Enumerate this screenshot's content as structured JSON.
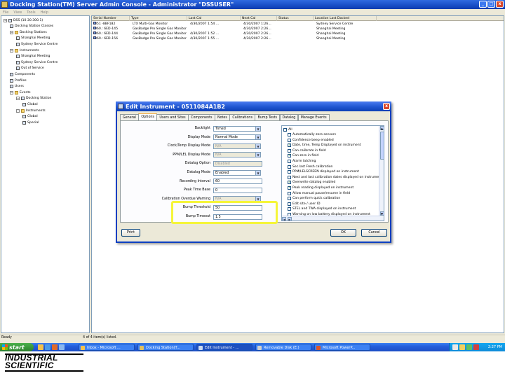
{
  "app": {
    "title": "Docking Station(TM) Server Admin Console - Administrator \"DSSUSER\"",
    "menu": [
      "File",
      "View",
      "Tools",
      "Help"
    ],
    "window_buttons": [
      "_",
      "□",
      "x"
    ]
  },
  "tree": {
    "items": [
      {
        "label": "DSS (10.30.300.1)",
        "icon": "computer-icon",
        "expander": "-"
      },
      {
        "label": "Docking Station Classes",
        "icon": "station-icon"
      },
      {
        "label": "Docking Stations",
        "icon": "station-icon",
        "expander": "-"
      },
      {
        "label": "Shanghai Meeting",
        "icon": "station-icon"
      },
      {
        "label": "Sydney Service Centre",
        "icon": "station-icon"
      },
      {
        "label": "Instruments",
        "icon": "instrument-icon",
        "expander": "-"
      },
      {
        "label": "Shanghai Meeting",
        "icon": "instrument-icon"
      },
      {
        "label": "Sydney Service Centre",
        "icon": "instrument-icon"
      },
      {
        "label": "Out of Service",
        "icon": "instrument-icon"
      },
      {
        "label": "Components",
        "icon": "component-icon"
      },
      {
        "label": "Profiles",
        "icon": "profile-icon"
      },
      {
        "label": "Users",
        "icon": "user-icon"
      },
      {
        "label": "Events",
        "icon": "event-icon",
        "expander": "-"
      },
      {
        "label": "Docking Station",
        "icon": "station-icon",
        "expander": "-"
      },
      {
        "label": "Global",
        "icon": "event-icon"
      },
      {
        "label": "Instruments",
        "icon": "instrument-icon",
        "expander": "-"
      },
      {
        "label": "Global",
        "icon": "event-icon"
      },
      {
        "label": "Special",
        "icon": "event-icon"
      }
    ]
  },
  "list": {
    "columns": [
      "Serial Number",
      "Type",
      "Last Cal",
      "Next Cal",
      "Status",
      "Location Last Docked"
    ],
    "rows": [
      [
        "051 -8BF182",
        "LTX Multi-Gas Monitor",
        "4/30/2007 1:54 ...",
        "4/30/2007 1:26...",
        "",
        "Sydney Service Centre"
      ],
      [
        "060.: 6ED-145",
        "GasBadge Pro Single Gas Monitor",
        "",
        "4/30/2007 2:26...",
        "",
        "Shanghai Meeting"
      ],
      [
        "060.: 6ED-144",
        "GasBadge Pro Single Gas Monitor",
        "4/30/2007 1:52 ...",
        "4/30/2007 2:26...",
        "",
        "Shanghai Meeting"
      ],
      [
        "060.: 6ED-156",
        "GasBadge Pro Single Gas Monitor",
        "4/30/2007 1:55 ...",
        "4/30/2007 2:26...",
        "",
        "Shanghai Meeting"
      ]
    ]
  },
  "status": {
    "left": "Ready",
    "middle": "4 of 4 item(s) listed."
  },
  "dialog": {
    "title": "Edit Instrument - 0511084A1B2",
    "tabs": [
      "General",
      "Options",
      "Users and Sites",
      "Components",
      "Notes",
      "Calibrations",
      "Bump Tests",
      "Datalog",
      "Manage Events"
    ],
    "active_tab": "Options",
    "fields": [
      {
        "label": "Backlight",
        "value": "Timed",
        "type": "dropdown",
        "enabled": true
      },
      {
        "label": "Display Mode",
        "value": "Normal Mode",
        "type": "dropdown",
        "enabled": true
      },
      {
        "label": "Clock/Temp Display Mode",
        "value": "N/A",
        "type": "dropdown",
        "enabled": false
      },
      {
        "label": "PPM/LEL Display Mode",
        "value": "N/A",
        "type": "dropdown",
        "enabled": false
      },
      {
        "label": "Datalog Option",
        "value": "Disabled",
        "type": "text",
        "enabled": false
      },
      {
        "label": "Datalog Mode",
        "value": "Enabled",
        "type": "dropdown",
        "enabled": true
      },
      {
        "label": "Recording Interval",
        "value": "60",
        "type": "text",
        "enabled": true
      },
      {
        "label": "Peak Time Base",
        "value": "0",
        "type": "text",
        "enabled": true
      },
      {
        "label": "Calibration Overdue Warning",
        "value": "N/A",
        "type": "dropdown",
        "enabled": false
      },
      {
        "label": "Bump Threshold",
        "value": "50",
        "type": "text",
        "enabled": true
      },
      {
        "label": "Bump Timeout",
        "value": "1.5",
        "type": "text",
        "enabled": true
      }
    ],
    "checklist": {
      "all_label": "All",
      "items": [
        {
          "label": "Automatically zero sensors",
          "checked": false
        },
        {
          "label": "Confidence beep enabled",
          "checked": false
        },
        {
          "label": "Date, time, Temp Displayed on instrument",
          "checked": true
        },
        {
          "label": "Can calibrate in field",
          "checked": false
        },
        {
          "label": "Can zero in field",
          "checked": true
        },
        {
          "label": "Alarm latching",
          "checked": false
        },
        {
          "label": "Sec.last Fresh calibration",
          "checked": false
        },
        {
          "label": "PPM/LELSCREEN displayed on instrument",
          "checked": false
        },
        {
          "label": "Next and last calibration dates displayed on instrument",
          "checked": false
        },
        {
          "label": "Overwrite datalog enabled",
          "checked": true
        },
        {
          "label": "Peak reading displayed on instrument",
          "checked": true
        },
        {
          "label": "Allow manual pause/resume in field",
          "checked": false
        },
        {
          "label": "Can perform quick calibration",
          "checked": false
        },
        {
          "label": "Edit site / user ID",
          "checked": false
        },
        {
          "label": "STEL and TWA displayed on instrument",
          "checked": false
        },
        {
          "label": "Warning on low battery displayed on instrument",
          "checked": false
        }
      ]
    },
    "buttons": {
      "print": "Print",
      "ok": "OK",
      "cancel": "Cancel"
    },
    "highlight_color": "#f5f53a"
  },
  "taskbar": {
    "start_label": "start",
    "tasks": [
      {
        "label": "Inbox - Microsoft ...",
        "icon_color": "#f2c14e"
      },
      {
        "label": "Docking Station(T...",
        "icon_color": "#e0c060"
      },
      {
        "label": "Edit Instrument - ...",
        "icon_color": "#c8d8f0",
        "active": true
      },
      {
        "label": "Removable Disk (E:)",
        "icon_color": "#cfcfcf"
      },
      {
        "label": "Microsoft PowerP...",
        "icon_color": "#d9542b"
      }
    ],
    "clock": "2:27 PM"
  },
  "branding": {
    "line1": "INDUSTRIAL",
    "line2": "SCIENTIFIC"
  },
  "colors": {
    "xp_blue": "#245edb",
    "start_green": "#3a9a3a",
    "highlight": "#f5f53a",
    "check_green": "#1a8a1a"
  }
}
